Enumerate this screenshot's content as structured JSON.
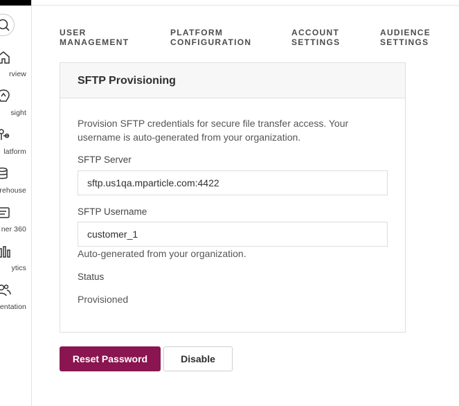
{
  "nav": {
    "items": [
      {
        "label": "rview",
        "icon": "home-icon"
      },
      {
        "label": "sight",
        "icon": "insight-icon"
      },
      {
        "label": "latform",
        "icon": "platform-icon"
      },
      {
        "label": "arehouse",
        "icon": "database-icon"
      },
      {
        "label": "ner 360",
        "icon": "id-card-icon"
      },
      {
        "label": "ytics",
        "icon": "bar-chart-icon"
      },
      {
        "label": "entation",
        "icon": "users-icon"
      }
    ]
  },
  "tabs": [
    {
      "line1": "USER",
      "line2": "MANAGEMENT"
    },
    {
      "line1": "PLATFORM",
      "line2": "CONFIGURATION"
    },
    {
      "line1": "ACCOUNT",
      "line2": "SETTINGS"
    },
    {
      "line1": "AUDIENCE",
      "line2": "SETTINGS"
    }
  ],
  "card": {
    "title": "SFTP Provisioning",
    "description": "Provision SFTP credentials for secure file transfer access. Your username is auto-generated from your organization.",
    "server_label": "SFTP Server",
    "server_value": "sftp.us1qa.mparticle.com:4422",
    "username_label": "SFTP Username",
    "username_value": "customer_1",
    "username_hint": "Auto-generated from your organization.",
    "status_label": "Status",
    "status_value": "Provisioned"
  },
  "actions": {
    "reset_label": "Reset Password",
    "disable_label": "Disable"
  },
  "colors": {
    "primary": "#8a1550"
  }
}
